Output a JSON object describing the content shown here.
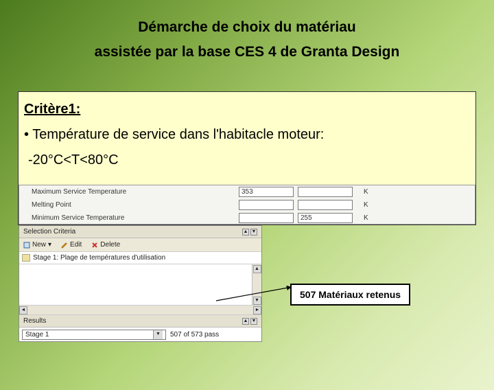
{
  "title_line1": "Démarche de choix du matériau",
  "title_line2": "assistée par la base CES 4  de Granta Design",
  "critere": {
    "heading": "Critère1:",
    "desc": "• Température de service dans l'habitacle moteur:",
    "range": "-20°C<T<80°C"
  },
  "props": {
    "rows": [
      {
        "label": "Maximum Service Temperature",
        "min": "353",
        "max": "",
        "unit": "K"
      },
      {
        "label": "Melting Point",
        "min": "",
        "max": "",
        "unit": "K"
      },
      {
        "label": "Minimum Service Temperature",
        "min": "",
        "max": "255",
        "unit": "K"
      }
    ]
  },
  "panel": {
    "header": "Selection Criteria",
    "toolbar": {
      "new": "New",
      "edit": "Edit",
      "delete": "Delete"
    },
    "stage_row": "Stage 1: Plage de températures d'utilisation",
    "results_label": "Results",
    "result_stage": "Stage 1",
    "result_count": "507 of 573 pass"
  },
  "callout": "507 Matériaux retenus"
}
